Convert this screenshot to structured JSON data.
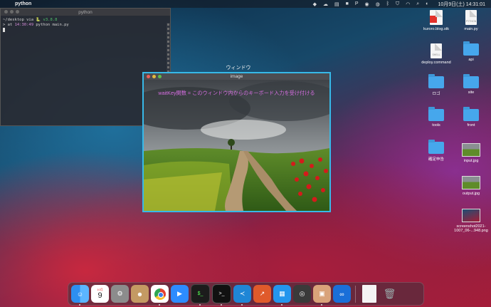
{
  "menubar": {
    "app_name": "python",
    "clock": "10月9日(土) 14:31:01",
    "status_icons": [
      "dropbox-icon",
      "cloud-icon",
      "docker-icon",
      "storage-icon",
      "p-icon",
      "colorwheel-icon",
      "gauge-icon",
      "bluetooth-icon",
      "shield-icon",
      "wifi-icon",
      "search-icon",
      "toggle-icon"
    ]
  },
  "terminal": {
    "title": "python",
    "line1_prefix": "~/desktop via",
    "line1_version": "v3.8.8",
    "line2_prefix": "> at",
    "line2_time": "14:30:49",
    "line2_cmd": "python main.py"
  },
  "window_caption": "ウィンドウ",
  "image_window": {
    "title": "image",
    "overlay_text": "waitKey関数 = このウィンドウ内からのキーボード入力を受け付ける"
  },
  "desktop_icons": [
    {
      "label": "kuroro.blog.stk",
      "kind": "doc-red"
    },
    {
      "label": "main.py",
      "kind": "doc",
      "tag": "PYTHON"
    },
    {
      "label": "deploy.command",
      "kind": "doc",
      "tag": "SHELL"
    },
    {
      "label": "api",
      "kind": "folder"
    },
    {
      "label": "ロゴ",
      "kind": "folder"
    },
    {
      "label": "site",
      "kind": "folder"
    },
    {
      "label": "tools",
      "kind": "folder"
    },
    {
      "label": "front",
      "kind": "folder"
    },
    {
      "label": "確定申告",
      "kind": "folder"
    },
    {
      "label": "input.jpg",
      "kind": "thumb"
    },
    {
      "label": "output.jpg",
      "kind": "thumb"
    },
    {
      "label": "screenshot2021-1007_06-...948.png",
      "kind": "thumb-red"
    }
  ],
  "dock": {
    "calendar_month": "10月",
    "calendar_day": "9",
    "apps": [
      "Finder",
      "Calendar",
      "System Preferences",
      "Contacts",
      "Chrome",
      "Zoom",
      "iTerm",
      "Terminal",
      "VS Code",
      "Instruments",
      "Docker",
      "QuickTime",
      "Preview",
      "Infinity",
      "Document",
      "Trash"
    ]
  }
}
